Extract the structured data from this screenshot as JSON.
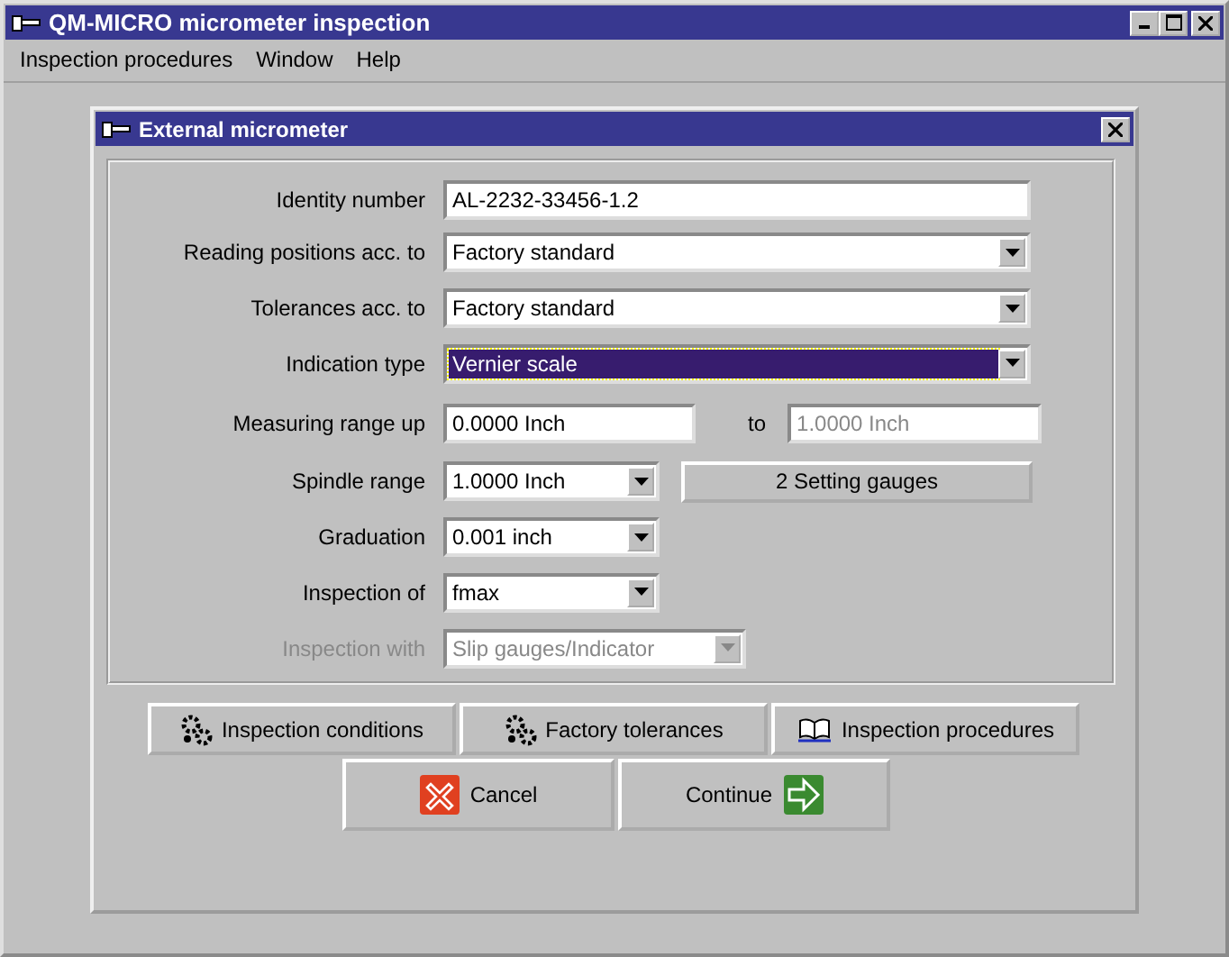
{
  "window": {
    "title": "QM-MICRO micrometer inspection"
  },
  "menu": [
    "Inspection procedures",
    "Window",
    "Help"
  ],
  "dialog": {
    "title": "External micrometer"
  },
  "fields": [
    {
      "label": "Identity number",
      "kind": "text",
      "value": "AL-2232-33456-1.2",
      "disabled": false,
      "focused": false
    },
    {
      "label": "Reading positions acc. to",
      "kind": "combo",
      "value": "Factory standard",
      "disabled": false,
      "focused": false
    },
    {
      "label": "Tolerances acc. to",
      "kind": "combo",
      "value": "Factory standard",
      "disabled": false,
      "focused": false
    },
    {
      "label": "Indication type",
      "kind": "combo",
      "value": "Vernier scale",
      "disabled": false,
      "focused": true
    },
    {
      "label": "Measuring range up",
      "kind": "range",
      "value": "0.0000 Inch",
      "to_label": "to",
      "to_value": "1.0000 Inch",
      "disabled": false,
      "focused": false
    },
    {
      "label": "Spindle range",
      "kind": "small_combo",
      "value": "1.0000 Inch",
      "button": "2 Setting gauges",
      "disabled": false,
      "focused": false
    },
    {
      "label": "Graduation",
      "kind": "small_combo",
      "value": "0.001 inch",
      "disabled": false,
      "focused": false
    },
    {
      "label": "Inspection of",
      "kind": "small_combo",
      "value": "fmax",
      "disabled": false,
      "focused": false
    },
    {
      "label": "Inspection with",
      "kind": "medium_combo",
      "value": "Slip gauges/Indicator",
      "disabled": true,
      "focused": false
    }
  ],
  "tool_buttons": [
    {
      "label": "Inspection conditions",
      "kind": "gears"
    },
    {
      "label": "Factory tolerances",
      "kind": "gears"
    },
    {
      "label": "Inspection procedures",
      "kind": "book"
    }
  ],
  "action_buttons": [
    {
      "label": "Cancel",
      "kind": "cancel"
    },
    {
      "label": "Continue",
      "kind": "continue"
    }
  ]
}
